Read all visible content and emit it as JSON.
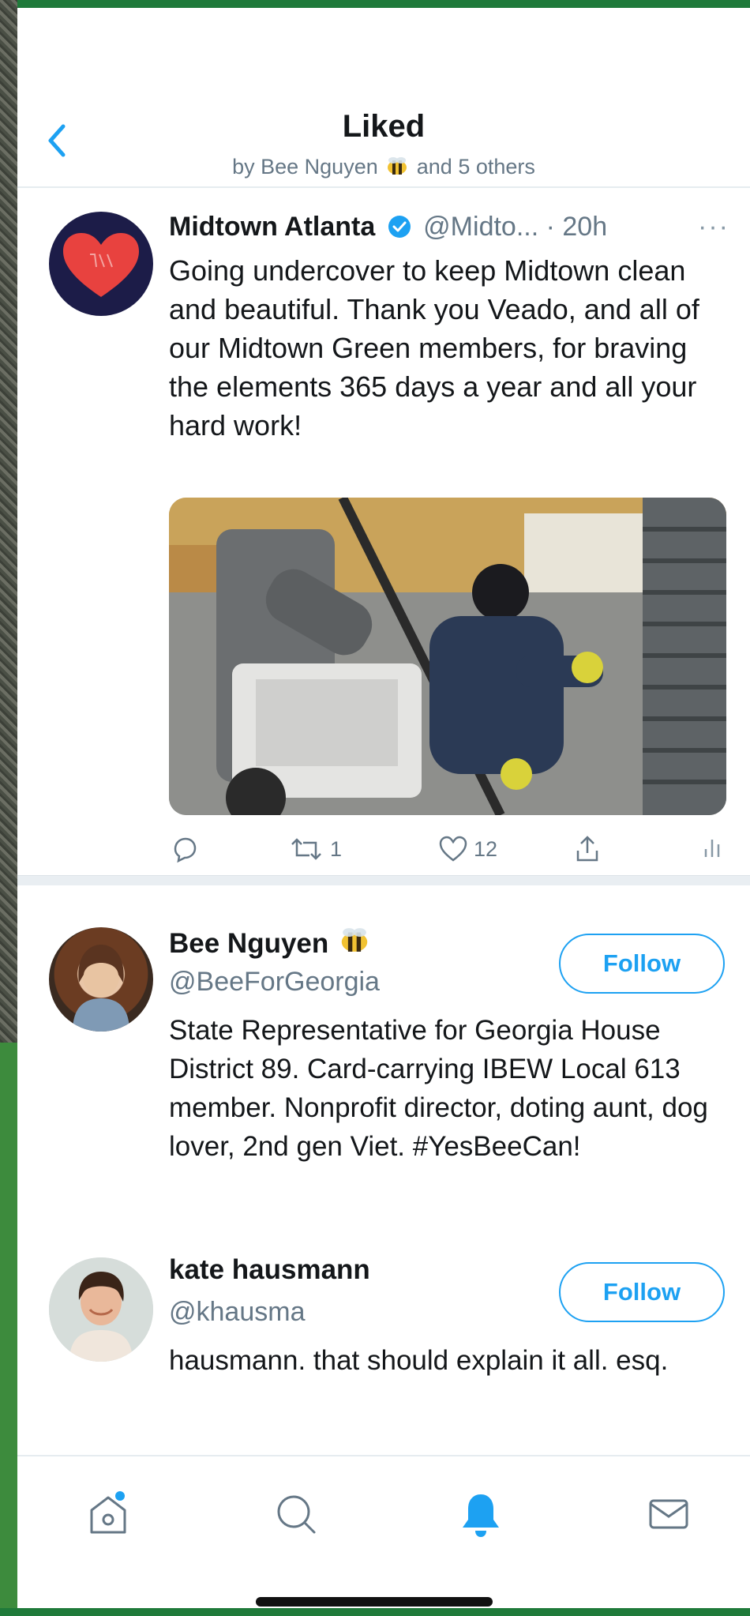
{
  "header": {
    "title": "Liked",
    "subtitle_prefix": "by Bee Nguyen",
    "subtitle_suffix": "and 5 others"
  },
  "tweet": {
    "author_name": "Midtown Atlanta",
    "handle": "@Midto...",
    "time": "· 20h",
    "more": "···",
    "text": "Going undercover to keep Midtown clean and beautiful. Thank you Veado, and all of our Midtown Green members, for braving the elements 365 days a year and all your hard work!",
    "retweet_count": "1",
    "like_count": "12"
  },
  "users": [
    {
      "name": "Bee Nguyen",
      "handle": "@BeeForGeorgia",
      "bio": "State Representative for Georgia House District 89. Card-carrying IBEW Local 613 member. Nonprofit director, doting aunt, dog lover, 2nd gen Viet. #YesBeeCan!",
      "follow_label": "Follow"
    },
    {
      "name": "kate hausmann",
      "handle": "@khausma",
      "bio": "hausmann. that should explain it all. esq.",
      "follow_label": "Follow"
    }
  ],
  "tabbar": {
    "items": [
      "home-icon",
      "search-icon",
      "notifications-bell-icon",
      "messages-mail-icon"
    ],
    "active": "notifications-bell-icon"
  },
  "colors": {
    "accent": "#1da1f2",
    "secondary_text": "#657786",
    "primary_text": "#14171a"
  }
}
